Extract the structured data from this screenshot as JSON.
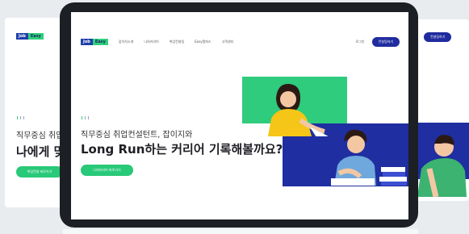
{
  "logo": {
    "part1": "Job",
    "part2": "Easy"
  },
  "nav": {
    "menu": [
      "잡이지소개",
      "나의커리어",
      "취업컨설팅",
      "Easy캠퍼스",
      "고객센터"
    ],
    "login": "로그인",
    "consult_button": "컨설팅하기"
  },
  "hero": {
    "subtitle": "직무중심 취업컨설턴트, 잡이지와",
    "title": "Long Run하는 커리어 기록해볼까요?",
    "cta": "나의커리어 바로가기"
  },
  "left_card": {
    "subtitle": "직무중심 취업",
    "title": "나에게 맞",
    "cta": "취업컨설 바로가기"
  },
  "right_card": {
    "consult_button": "컨설팅하기"
  },
  "colors": {
    "brand_blue": "#1f2ea0",
    "brand_green": "#2ecc7c",
    "frame": "#1c1f24"
  }
}
